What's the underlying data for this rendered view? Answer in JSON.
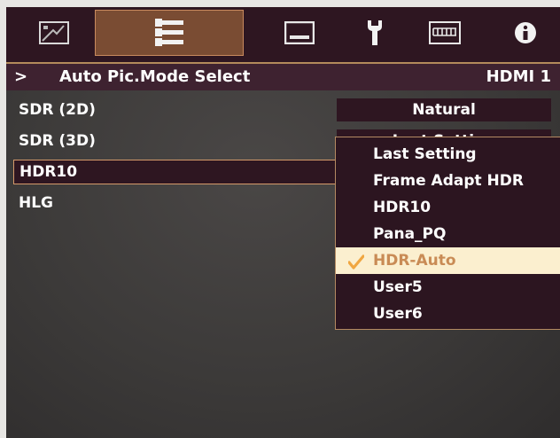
{
  "tabs": [
    {
      "icon": "picture-icon",
      "active": false
    },
    {
      "icon": "adjust-sliders-icon",
      "active": true
    },
    {
      "icon": "screen-icon",
      "active": false
    },
    {
      "icon": "wrench-icon",
      "active": false
    },
    {
      "icon": "keyboard-icon",
      "active": false
    },
    {
      "icon": "info-icon",
      "active": false
    }
  ],
  "header": {
    "chevron": ">",
    "title": "Auto Pic.Mode Select",
    "source": "HDMI 1"
  },
  "settings": [
    {
      "label": "SDR (2D)",
      "value": "Natural"
    },
    {
      "label": "SDR (3D)",
      "value": "Last Setting"
    },
    {
      "label": "HDR10",
      "value": ""
    },
    {
      "label": "HLG",
      "value": ""
    }
  ],
  "dropdown": {
    "options": [
      "Last Setting",
      "Frame Adapt HDR",
      "HDR10",
      "Pana_PQ",
      "HDR-Auto",
      "User5",
      "User6"
    ],
    "selected_index": 4,
    "colors": {
      "highlight_bg": "#fbefcf",
      "highlight_text": "#c98b55",
      "check": "#f0a640"
    }
  },
  "colors": {
    "tab_bar": "#2e1621",
    "active_tab": "#7a4c33",
    "header_bg": "#3e2230",
    "accent_border": "#d59a6a"
  }
}
